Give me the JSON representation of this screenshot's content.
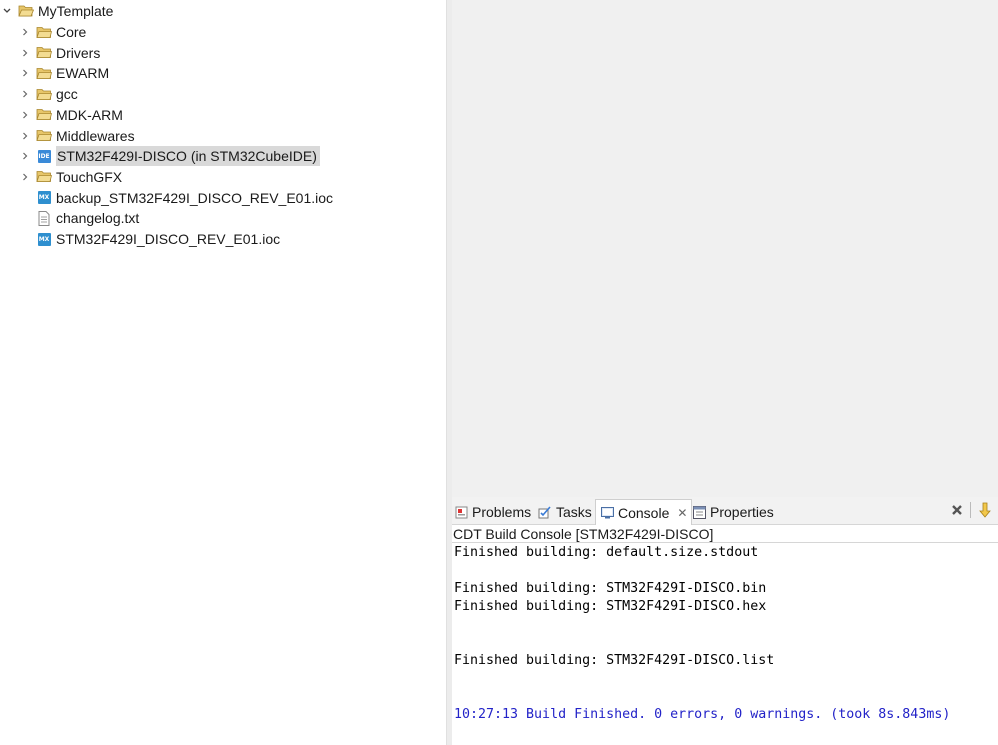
{
  "explorer": {
    "root": {
      "label": "MyTemplate",
      "icon": "open-folder-icon"
    },
    "items": [
      {
        "label": "Core",
        "icon": "folder-icon",
        "expandable": true
      },
      {
        "label": "Drivers",
        "icon": "folder-icon",
        "expandable": true
      },
      {
        "label": "EWARM",
        "icon": "folder-icon",
        "expandable": true
      },
      {
        "label": "gcc",
        "icon": "folder-icon",
        "expandable": true
      },
      {
        "label": "MDK-ARM",
        "icon": "folder-icon",
        "expandable": true
      },
      {
        "label": "Middlewares",
        "icon": "folder-icon",
        "expandable": true
      },
      {
        "label": "STM32F429I-DISCO (in STM32CubeIDE)",
        "icon": "ide-project-icon",
        "expandable": true,
        "selected": true,
        "badge": "IDE"
      },
      {
        "label": "TouchGFX",
        "icon": "folder-icon",
        "expandable": true
      },
      {
        "label": "backup_STM32F429I_DISCO_REV_E01.ioc",
        "icon": "mx-file-icon",
        "expandable": false,
        "badge": "MX"
      },
      {
        "label": "changelog.txt",
        "icon": "text-file-icon",
        "expandable": false
      },
      {
        "label": "STM32F429I_DISCO_REV_E01.ioc",
        "icon": "mx-file-icon",
        "expandable": false,
        "badge": "MX"
      }
    ]
  },
  "console_panel": {
    "tabs": [
      {
        "label": "Problems",
        "icon": "problems-icon"
      },
      {
        "label": "Tasks",
        "icon": "tasks-icon"
      },
      {
        "label": "Console",
        "icon": "console-icon",
        "active": true,
        "closable": true
      },
      {
        "label": "Properties",
        "icon": "properties-icon"
      }
    ],
    "toolbar": [
      "clear-console-icon",
      "scroll-lock-icon"
    ],
    "title": "CDT Build Console [STM32F429I-DISCO]",
    "lines": [
      "Finished building: default.size.stdout",
      "",
      "Finished building: STM32F429I-DISCO.bin",
      "Finished building: STM32F429I-DISCO.hex",
      "",
      "",
      "Finished building: STM32F429I-DISCO.list",
      "",
      "",
      "10:27:13 Build Finished. 0 errors, 0 warnings. (took 8s.843ms)"
    ],
    "colors": {
      "summary_line": "#2323c8"
    }
  }
}
